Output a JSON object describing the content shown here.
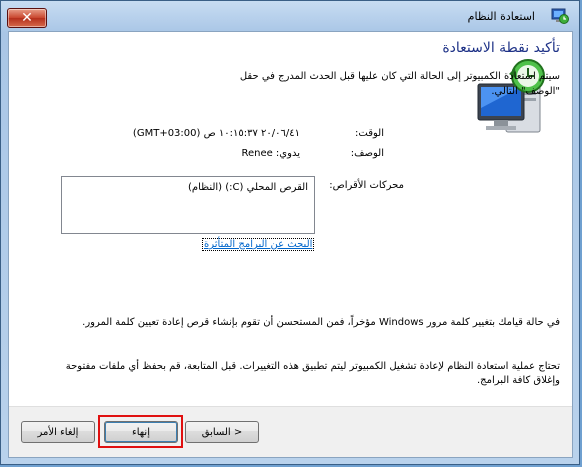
{
  "window": {
    "title": "استعادة النظام",
    "close_symbol": "✕"
  },
  "page": {
    "heading": "تأكيد نقطة الاستعادة",
    "intro": "سيتم استعادة الكمبيوتر إلى الحالة التي كان عليها قبل الحدث المدرج في حقل \"الوصف\" التالي.",
    "time_label": "الوقت:",
    "time_value": "٢٠/٠٦/٤١ ١٠:١٥:٣٧ ص (GMT+03:00)",
    "description_label": "الوصف:",
    "description_value": "يدوي: Renee",
    "drives_label": "محركات الأقراص:",
    "drives": [
      "القرص المحلي (C:) (النظام)"
    ],
    "affected_link": "البحث عن البرامج المتأثرة",
    "password_note": "في حالة قيامك بتغيير كلمة مرور Windows مؤخراً، فمن المستحسن أن تقوم بإنشاء قرص إعادة تعيين كلمة المرور.",
    "restart_note": "تحتاج عملية استعادة النظام لإعادة تشغيل الكمبيوتر ليتم تطبيق هذه التغييرات. قبل المتابعة، قم بحفظ أي ملفات مفتوحة وإغلاق كافة البرامج."
  },
  "footer": {
    "back_label": "< السابق",
    "finish_label": "إنهاء",
    "cancel_label": "إلغاء الأمر"
  },
  "colors": {
    "heading": "#1e3287",
    "link": "#0066cc",
    "highlight": "#e01010"
  },
  "icons": {
    "title_icon": "system-restore-icon",
    "illustration": "computer-restore-icon"
  }
}
